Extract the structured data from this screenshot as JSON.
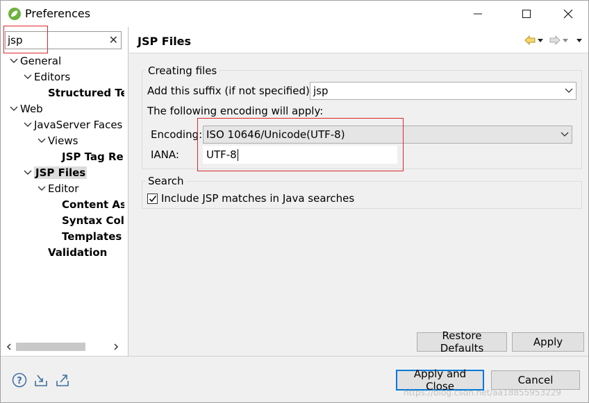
{
  "window": {
    "title": "Preferences"
  },
  "filter": {
    "value": "jsp"
  },
  "tree": [
    {
      "label": "General",
      "indent": 0,
      "expanded": true,
      "bold": false
    },
    {
      "label": "Editors",
      "indent": 1,
      "expanded": true,
      "bold": false
    },
    {
      "label": "Structured Te",
      "indent": 2,
      "expanded": null,
      "bold": true
    },
    {
      "label": "Web",
      "indent": 0,
      "expanded": true,
      "bold": false
    },
    {
      "label": "JavaServer Faces",
      "indent": 1,
      "expanded": true,
      "bold": false
    },
    {
      "label": "Views",
      "indent": 2,
      "expanded": true,
      "bold": false
    },
    {
      "label": "JSP Tag Re",
      "indent": 3,
      "expanded": null,
      "bold": true
    },
    {
      "label": "JSP Files",
      "indent": 1,
      "expanded": true,
      "bold": true,
      "selected": true
    },
    {
      "label": "Editor",
      "indent": 2,
      "expanded": true,
      "bold": false
    },
    {
      "label": "Content As",
      "indent": 3,
      "expanded": null,
      "bold": true
    },
    {
      "label": "Syntax Col",
      "indent": 3,
      "expanded": null,
      "bold": true
    },
    {
      "label": "Templates",
      "indent": 3,
      "expanded": null,
      "bold": true
    },
    {
      "label": "Validation",
      "indent": 2,
      "expanded": null,
      "bold": true
    }
  ],
  "page": {
    "title": "JSP Files",
    "creating_files": {
      "group_title": "Creating files",
      "suffix_label": "Add this suffix (if not specified):",
      "suffix_value": "jsp",
      "encoding_note": "The following encoding will apply:",
      "encoding_label": "Encoding:",
      "encoding_value": "ISO 10646/Unicode(UTF-8)",
      "iana_label": "IANA:",
      "iana_value": "UTF-8"
    },
    "search": {
      "group_title": "Search",
      "include_label": "Include JSP matches in Java searches",
      "include_checked": true
    },
    "restore_defaults": "Restore Defaults",
    "apply": "Apply"
  },
  "footer": {
    "apply_close": "Apply and Close",
    "cancel": "Cancel"
  },
  "watermark": "https://blog.csdn.net/aa18855953229",
  "colors": {
    "highlight_red": "#d9262c",
    "default_button_border": "#0078d7",
    "selection_bg": "#dcdcdc"
  }
}
